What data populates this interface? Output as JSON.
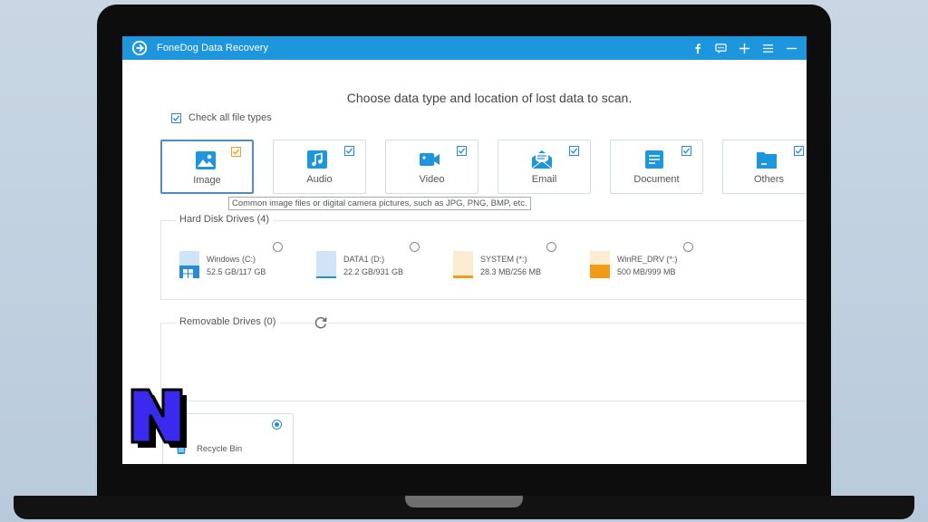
{
  "window": {
    "title": "FoneDog Data Recovery",
    "title_icons": [
      "facebook-icon",
      "chat-icon",
      "plus-icon",
      "menu-icon",
      "minimize-icon"
    ]
  },
  "main": {
    "heading": "Choose data type and location of lost data to scan.",
    "check_all_label": "Check all file types",
    "check_all_checked": true
  },
  "types": [
    {
      "label": "Image",
      "icon": "image-icon",
      "checked": true,
      "selected": true
    },
    {
      "label": "Audio",
      "icon": "audio-icon",
      "checked": true
    },
    {
      "label": "Video",
      "icon": "video-icon",
      "checked": true
    },
    {
      "label": "Email",
      "icon": "email-icon",
      "checked": true
    },
    {
      "label": "Document",
      "icon": "document-icon",
      "checked": true
    },
    {
      "label": "Others",
      "icon": "folder-icon",
      "checked": true
    }
  ],
  "tooltip": "Common image files or digital camera pictures, such as JPG, PNG, BMP, etc.",
  "hard_disk": {
    "title": "Hard Disk Drives (4)",
    "drives": [
      {
        "name": "Windows (C:)",
        "size": "52.5 GB/117 GB",
        "fill": 0.45,
        "color": "#2a8ad4"
      },
      {
        "name": "DATA1 (D:)",
        "size": "22.2 GB/931 GB",
        "fill": 0.02,
        "color": "#2a8ad4"
      },
      {
        "name": "SYSTEM (*:)",
        "size": "28.3 MB/256 MB",
        "fill": 0.11,
        "color": "#f39a16"
      },
      {
        "name": "WinRE_DRV (*:)",
        "size": "500 MB/999 MB",
        "fill": 0.5,
        "color": "#f39a16"
      }
    ]
  },
  "removable": {
    "title": "Removable Drives (0)"
  },
  "recycle_bin": {
    "label": "Recycle Bin",
    "selected": true
  },
  "colors": {
    "accent": "#1e96de",
    "disk_blue": "#2a8ad4",
    "disk_orange": "#f39a16"
  }
}
